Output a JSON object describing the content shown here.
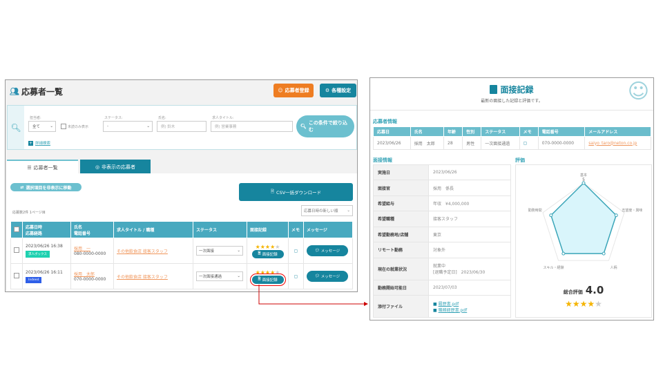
{
  "list": {
    "title": "応募者一覧",
    "register_button": "応募者登録",
    "settings_button": "各種設定",
    "filter": {
      "assignee_label": "担当者:",
      "assignee_value": "全て",
      "unread_label": "未読のみ表示",
      "status_label": "ステータス:",
      "status_value": "-",
      "name_label": "氏名:",
      "name_placeholder": "例) 鈴木",
      "job_label": "求人タイトル:",
      "job_placeholder": "例) 営業事務",
      "search_button": "この条件で絞り込む",
      "advanced_link": "詳細検索"
    },
    "tabs": [
      "応募者一覧",
      "非表示の応募者"
    ],
    "hide_button": "選択項目を非表示に移動",
    "csv_button": "CSV一括ダウンロード",
    "count_text": "応募数2件 1ページ目",
    "sort_value": "応募日時の新しい順",
    "columns": [
      "応募日時",
      "応募経路",
      "氏名",
      "電話番号",
      "求人タイトル / 職種",
      "ステータス",
      "面接記録",
      "メモ",
      "メッセージ"
    ],
    "rows": [
      {
        "datetime": "2023/06/26 16:38",
        "source": "求人ボックス",
        "source_color": "#1fd1b0",
        "name": "採用　一",
        "phone": "080-0000-0000",
        "job": "その他飲食店 接客スタッフ",
        "status": "一次面接",
        "rating": 4,
        "interview_button": "面接記録",
        "message_button": "メッセージ"
      },
      {
        "datetime": "2023/06/26 16:11",
        "source": "Indeed",
        "source_color": "#2f5fe8",
        "name": "採用　太郎",
        "phone": "070-0000-0000",
        "job": "その他飲食店 接客スタッフ",
        "status": "一次面接通過",
        "rating": 4,
        "interview_button": "面接記録",
        "message_button": "メッセージ"
      }
    ]
  },
  "record": {
    "title": "面接記録",
    "subtitle": "最新の面接した記録と評価です。",
    "applicant_section": "応募者情報",
    "applicant_columns": [
      "応募日",
      "氏名",
      "年齢",
      "性別",
      "ステータス",
      "メモ",
      "電話番号",
      "メールアドレス"
    ],
    "applicant": {
      "date": "2023/06/26",
      "name": "採用　太郎",
      "age": "28",
      "gender": "男性",
      "status": "一次面接通過",
      "phone": "070-0000-0000",
      "email": "saiyo_taro@neton.co.jp"
    },
    "interview_section": "面接情報",
    "interview": [
      {
        "k": "実施日",
        "v": "2023/06/26"
      },
      {
        "k": "面接官",
        "v": "採用　係長"
      },
      {
        "k": "希望給与",
        "v": "年収　¥4,000,000"
      },
      {
        "k": "希望職種",
        "v": "接客スタッフ"
      },
      {
        "k": "希望勤務地/店舗",
        "v": "東京"
      },
      {
        "k": "リモート勤務",
        "v": "対象外"
      },
      {
        "k": "現在の就業状況",
        "v": "就業中",
        "v2": "[退職予定日]　2023/06/30"
      },
      {
        "k": "勤務開始可能日",
        "v": "2023/07/03"
      },
      {
        "k": "添付ファイル",
        "files": [
          "履歴書.pdf",
          "職務経歴書.pdf"
        ]
      }
    ],
    "eval_section": "評価",
    "total_label": "総合評価",
    "total_score": "4.0",
    "total_rating": 4,
    "scale_max_label": "5"
  },
  "chart_data": {
    "type": "radar",
    "categories": [
      "基本",
      "志望度・興味",
      "人柄",
      "スキル・経験",
      "勤務時間"
    ],
    "values": [
      5,
      4,
      4,
      4,
      4
    ],
    "rlim": [
      0,
      5
    ]
  },
  "colors": {
    "teal": "#16859e",
    "orange": "#ee7d22",
    "accent": "#48a9bf"
  }
}
